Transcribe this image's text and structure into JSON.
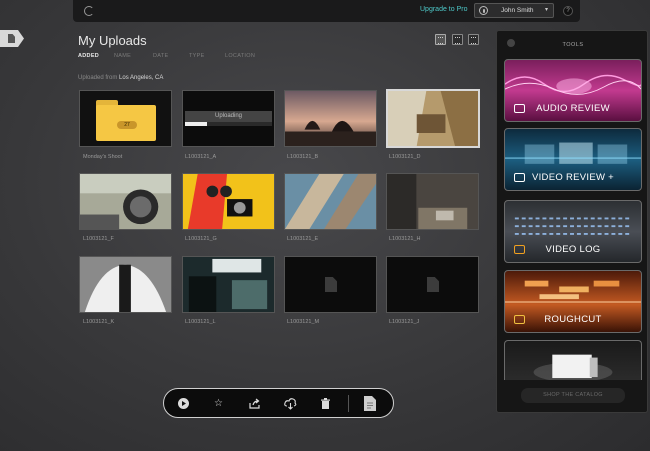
{
  "header": {
    "upgrade_label": "Upgrade to Pro",
    "user_name": "John Smith",
    "help_label": "?"
  },
  "main": {
    "title": "My Uploads",
    "sort_tabs": [
      "ADDED",
      "NAME",
      "DATE",
      "TYPE",
      "LOCATION"
    ],
    "active_sort": "ADDED",
    "uploaded_from_prefix": "Uploaded from",
    "uploaded_from_location": "Los Angeles, CA"
  },
  "items": [
    {
      "caption": "Monday's Shoot",
      "kind": "folder",
      "badge": "27"
    },
    {
      "caption": "L1003121_A",
      "kind": "uploading",
      "status": "Uploading",
      "progress": 0.25
    },
    {
      "caption": "L1003121_B",
      "kind": "image"
    },
    {
      "caption": "L1003121_D",
      "kind": "image",
      "selected": true
    },
    {
      "caption": "L1003121_F",
      "kind": "image"
    },
    {
      "caption": "L1003121_G",
      "kind": "image"
    },
    {
      "caption": "L1003121_E",
      "kind": "image"
    },
    {
      "caption": "L1003121_H",
      "kind": "image"
    },
    {
      "caption": "L1003121_K",
      "kind": "image"
    },
    {
      "caption": "L1003121_L",
      "kind": "image"
    },
    {
      "caption": "L1003121_M",
      "kind": "placeholder"
    },
    {
      "caption": "L1003121_J",
      "kind": "placeholder"
    }
  ],
  "toolbar": {
    "icons": [
      "play-icon",
      "star-icon",
      "share-icon",
      "download-icon",
      "trash-icon",
      "document-icon"
    ]
  },
  "tools_panel": {
    "title": "TOOLS",
    "tools": [
      {
        "label": "AUDIO REVIEW",
        "accent": "#e040a0"
      },
      {
        "label": "VIDEO REVIEW +",
        "accent": "#4ab8e0"
      },
      {
        "label": "VIDEO LOG",
        "accent": "#8fc0ff"
      },
      {
        "label": "ROUGHCUT",
        "accent": "#e8702a"
      }
    ],
    "shop_label": "SHOP THE CATALOG"
  }
}
